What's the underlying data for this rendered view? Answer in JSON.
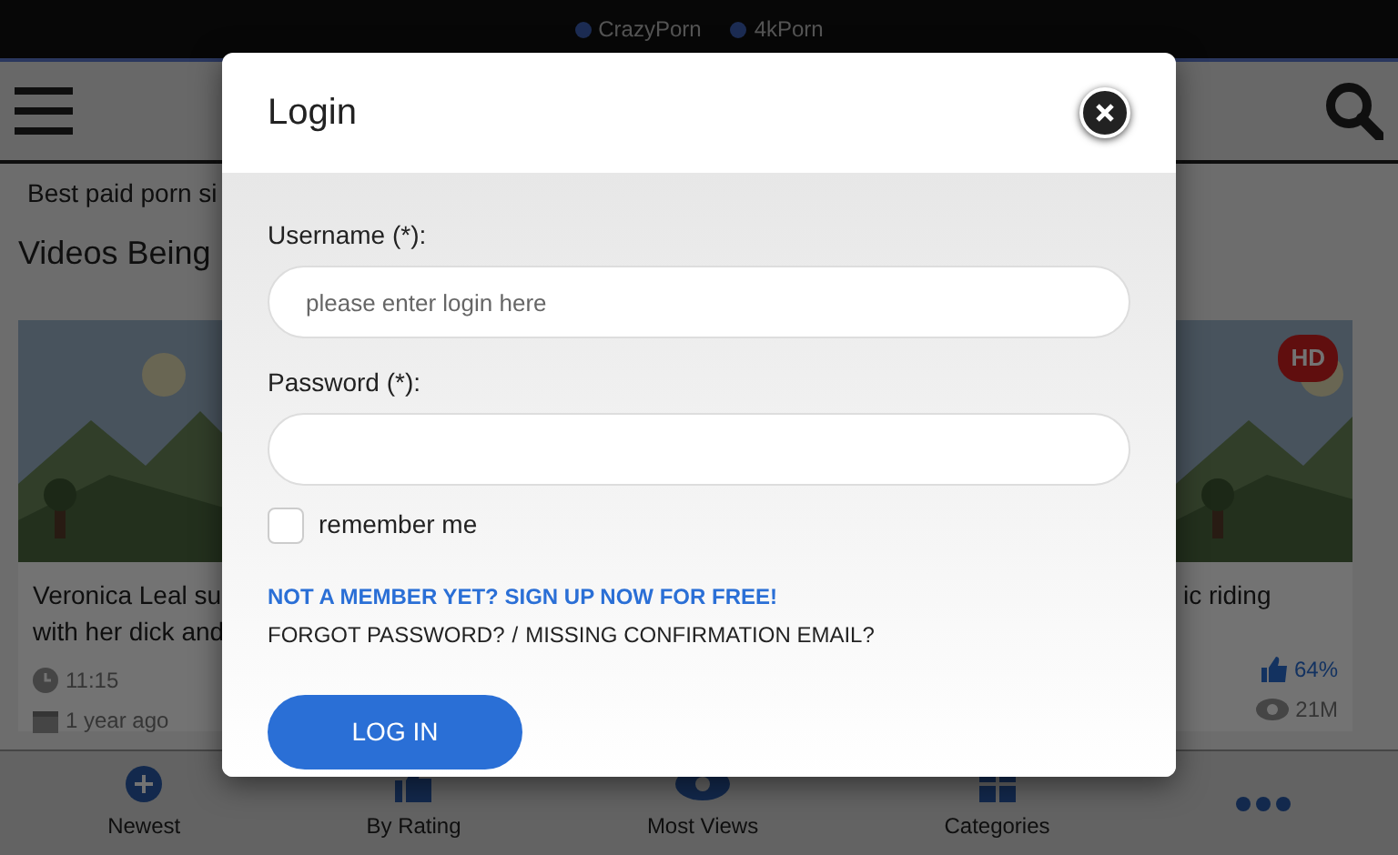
{
  "top_links": [
    {
      "label": "CrazyPorn"
    },
    {
      "label": "4kPorn"
    }
  ],
  "tagline": "Best paid porn si",
  "section_title": "Videos Being",
  "videos": [
    {
      "hd": false,
      "title_lines": [
        "Veronica Leal su",
        "with her dick and"
      ],
      "meta": [
        {
          "kind": "duration",
          "text": "11:15"
        },
        {
          "kind": "age",
          "text": "1 year ago"
        }
      ]
    },
    {
      "hd": true,
      "badge": "HD",
      "title_lines": [
        "ic riding"
      ],
      "meta": [
        {
          "kind": "rating",
          "text": "64%"
        },
        {
          "kind": "views",
          "text": "21M"
        }
      ]
    }
  ],
  "modal": {
    "title": "Login",
    "username_label": "Username (*):",
    "username_placeholder": "please enter login here",
    "password_label": "Password (*):",
    "remember": {
      "label": "remember me",
      "checked": false
    },
    "signup_link": "NOT A MEMBER YET? SIGN UP NOW FOR FREE!",
    "forgot_link": "FORGOT PASSWORD?",
    "separator": "/",
    "missing_link": "MISSING CONFIRMATION EMAIL?",
    "submit": "LOG IN"
  },
  "bottom_nav": [
    {
      "kind": "plus",
      "label": "Newest"
    },
    {
      "kind": "rating",
      "label": "By Rating"
    },
    {
      "kind": "views",
      "label": "Most Views"
    },
    {
      "kind": "categories",
      "label": "Categories"
    },
    {
      "kind": "more"
    }
  ]
}
